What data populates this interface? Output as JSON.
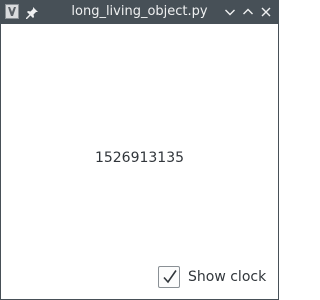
{
  "window": {
    "title": "long_living_object.py"
  },
  "titlebar": {
    "app_icon": "app-icon",
    "pin_icon": "pin-icon",
    "buttons": [
      "minimize-icon",
      "maximize-icon",
      "close-icon"
    ]
  },
  "main": {
    "clock_value": "1526913135",
    "show_clock": {
      "label": "Show clock",
      "checked": true
    }
  },
  "colors": {
    "titlebar_bg": "#475057",
    "titlebar_text": "#eff0f1",
    "client_bg": "#ffffff",
    "text": "#31363b"
  }
}
